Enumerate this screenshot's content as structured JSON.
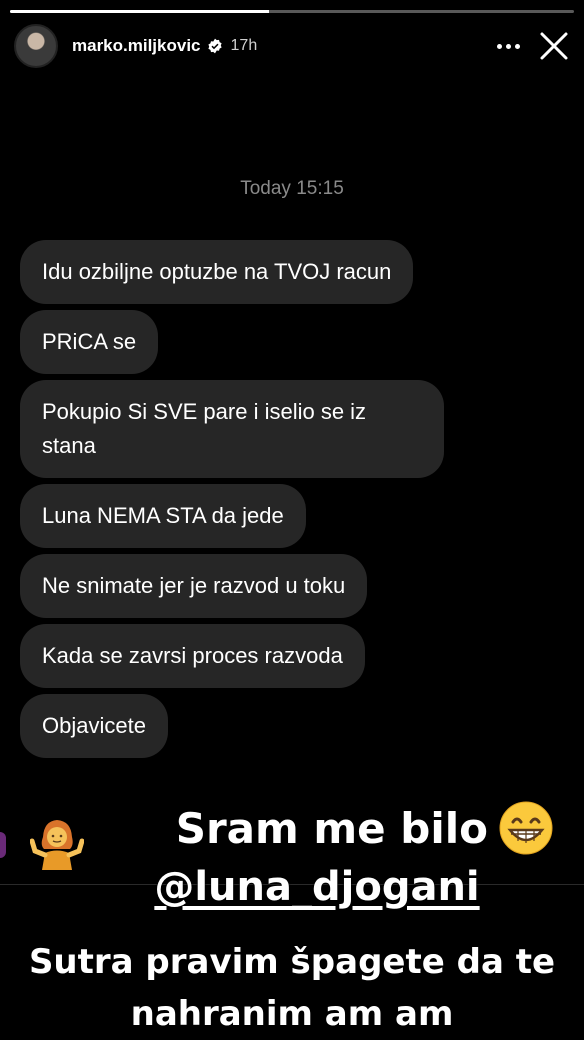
{
  "story": {
    "progress": 0.46,
    "username": "marko.miljkovic",
    "time_ago": "17h",
    "verified": true
  },
  "chat": {
    "timestamp": "Today 15:15",
    "messages": [
      "Idu ozbiljne optuzbe na TVOJ racun",
      "PRiCA se",
      "Pokupio Si SVE pare i iselio se iz stana",
      "Luna NEMA STA da jede",
      "Ne snimate jer je razvod u toku",
      "Kada se zavrsi proces razvoda",
      "Objavicete"
    ]
  },
  "overlay": {
    "line1": "Sram me bilo",
    "line1_emoji": "grinning-face-icon",
    "mention": "@luna_djogani",
    "line3a": "Sutra pravim špagete da te",
    "line3b": "nahranim am am"
  },
  "colors": {
    "background": "#000000",
    "bubble": "#262626",
    "timestamp": "#8a8a8a"
  }
}
